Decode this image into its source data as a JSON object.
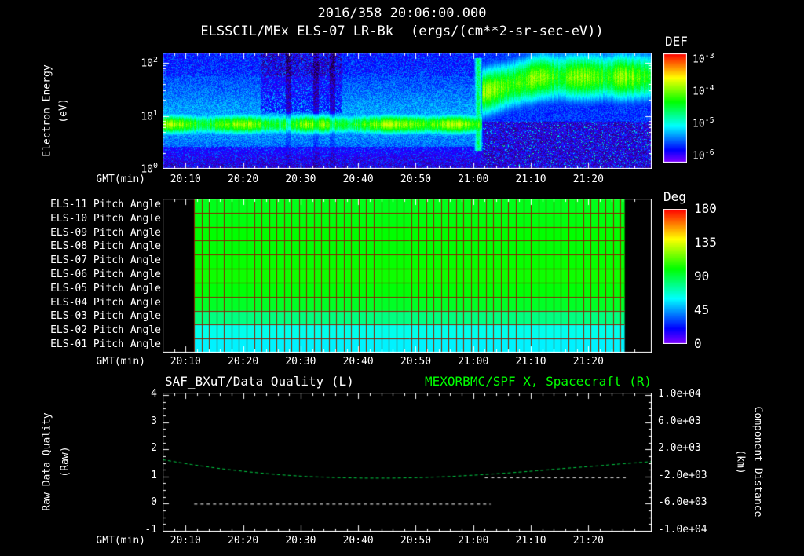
{
  "title": {
    "date_line": "2016/358 20:06:00.000",
    "instrument": "ELSSCIL/MEx ELS-07 LR-Bk",
    "units": "(ergs/(cm**2-sr-sec-eV))"
  },
  "time_axis": {
    "label": "GMT(min)",
    "start_label": "20:06",
    "range_minutes": [
      0,
      85
    ],
    "tick_minutes": [
      4,
      14,
      24,
      34,
      44,
      54,
      64,
      74
    ],
    "tick_labels": [
      "20:10",
      "20:20",
      "20:30",
      "20:40",
      "20:50",
      "21:00",
      "21:10",
      "21:20"
    ]
  },
  "colors": {
    "background": "#000000",
    "foreground": "#ffffff",
    "title_green": "#00ff00",
    "series_green": "#00cc44",
    "series_white": "#ffffff",
    "pitch_grid": "#8b2000"
  },
  "left_labels": {
    "electron_energy_1": "Electron Energy",
    "electron_energy_2": "(eV)",
    "raw_quality_1": "Raw Data Quality",
    "raw_quality_2": "(Raw)"
  },
  "right_labels": {
    "component_distance_1": "Component Distance",
    "component_distance_2": "(km)"
  },
  "chart_data": [
    {
      "id": "electron-energy-spectrogram",
      "type": "heatmap",
      "title": "ELSSCIL/MEx ELS-07 LR-Bk",
      "units": "ergs/(cm**2-sr-sec-eV)",
      "xlabel": "GMT(min)",
      "ylabel": "Electron Energy (eV)",
      "y_scale": "log",
      "ylim_ev": [
        1,
        155
      ],
      "y_tick_exponents": [
        2,
        1,
        0
      ],
      "colorbar": {
        "label": "DEF",
        "scale": "log",
        "tick_exponents": [
          -3,
          -4,
          -5,
          -6
        ],
        "range": [
          1e-06,
          0.001
        ]
      },
      "features": {
        "background_level": 0.15,
        "low_energy_band": {
          "center_ev": 7,
          "sigma_log10": 0.14,
          "t_minutes": [
            0,
            55.5
          ],
          "peak_value": 0.6,
          "note": "bright green 4-10 eV band from 20:06 until ~21:00"
        },
        "dark_patches": {
          "t_minutes": [
            17,
            31
          ],
          "above_ev": 11,
          "note": "dark columns at high energies 20:23-20:37"
        },
        "gap_columns_t": [
          21.8,
          26.6,
          29.5
        ],
        "transition_streak": {
          "t_minute": 54.8,
          "ev_range": [
            2.5,
            120
          ],
          "note": "bright vertical edge near 21:00"
        },
        "high_energy_band": {
          "center_ev_start": 28,
          "center_ev_end": 55,
          "sigma_log10": 0.32,
          "t_minutes": [
            55.5,
            85
          ],
          "peak_value": 0.62,
          "note": "broad green band ~10-100 eV after 21:00 to end"
        }
      }
    },
    {
      "id": "pitch-angle-panel",
      "type": "heatmap",
      "colorbar": {
        "label": "Deg",
        "ticks": [
          180,
          135,
          90,
          45,
          0
        ],
        "range": [
          0,
          180
        ]
      },
      "data_t_minutes": [
        5.5,
        80.3
      ],
      "grid_minutes_step": 1.3,
      "rows": [
        {
          "label": "ELS-11 Pitch Angle",
          "deg": 96
        },
        {
          "label": "ELS-10 Pitch Angle",
          "deg": 98
        },
        {
          "label": "ELS-09 Pitch Angle",
          "deg": 100
        },
        {
          "label": "ELS-08 Pitch Angle",
          "deg": 99
        },
        {
          "label": "ELS-07 Pitch Angle",
          "deg": 101
        },
        {
          "label": "ELS-06 Pitch Angle",
          "deg": 102
        },
        {
          "label": "ELS-05 Pitch Angle",
          "deg": 99
        },
        {
          "label": "ELS-04 Pitch Angle",
          "deg": 94
        },
        {
          "label": "ELS-03 Pitch Angle",
          "deg": 80
        },
        {
          "label": "ELS-02 Pitch Angle",
          "deg": 63
        },
        {
          "label": "ELS-01 Pitch Angle",
          "deg": 58
        }
      ]
    },
    {
      "id": "quality-distance-timeseries",
      "type": "line",
      "left_title": "SAF_BXuT/Data Quality (L)",
      "right_title": "MEXORBMC/SPF X, Spacecraft (R)",
      "left_axis": {
        "label": "Raw Data Quality (Raw)",
        "range": [
          -1,
          4
        ],
        "ticks": [
          4,
          3,
          2,
          1,
          0,
          -1
        ]
      },
      "right_axis": {
        "label": "Component Distance (km)",
        "range_km": [
          -10000,
          10000
        ],
        "tick_labels": [
          "1.0e+04",
          "6.0e+03",
          "2.0e+03",
          "-2.0e+03",
          "-6.0e+03",
          "-1.0e+04"
        ]
      },
      "series": [
        {
          "name": "SAF_BXuT/Data Quality (L)",
          "axis": "left",
          "color": "#ffffff",
          "line_style": "dashed",
          "segments": [
            {
              "t_minutes": [
                5.5,
                57
              ],
              "value": 0
            },
            {
              "t_minutes": [
                56,
                80.5
              ],
              "value": 0.97
            }
          ]
        },
        {
          "name": "MEXORBMC/SPF X, Spacecraft (R)",
          "axis": "right",
          "color": "#00cc44",
          "line_style": "dashed",
          "t_minutes": [
            0,
            5,
            10,
            15,
            20,
            25,
            30,
            35,
            40,
            45,
            50,
            55,
            60,
            65,
            70,
            75,
            80,
            85
          ],
          "values_km": [
            480,
            -240,
            -840,
            -1320,
            -1720,
            -2000,
            -2160,
            -2240,
            -2240,
            -2160,
            -2000,
            -1760,
            -1480,
            -1160,
            -800,
            -480,
            -120,
            200
          ]
        }
      ]
    }
  ]
}
